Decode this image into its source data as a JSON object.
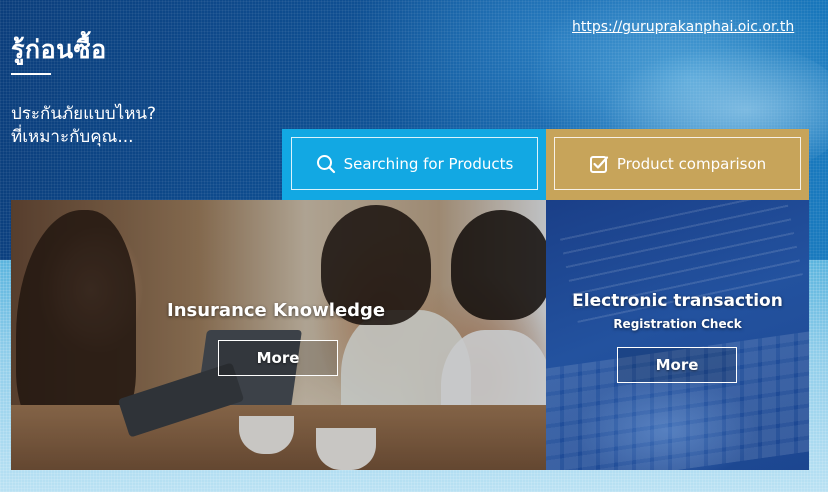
{
  "header": {
    "title": "รู้ก่อนซื้อ",
    "subtitle_line1": "ประกันภัยแบบไหน?",
    "subtitle_line2": "ที่เหมาะกับคุณ...",
    "url": "https://guruprakanphai.oic.or.th"
  },
  "actions": {
    "search": {
      "label": "Searching for Products",
      "icon": "search-icon"
    },
    "compare": {
      "label": "Product comparison",
      "icon": "checkbox-icon"
    }
  },
  "cards": {
    "knowledge": {
      "title": "Insurance Knowledge",
      "button": "More"
    },
    "electronic": {
      "title": "Electronic transaction",
      "subtitle": "Registration Check",
      "button": "More"
    }
  },
  "colors": {
    "search_panel": "#12a8e3",
    "compare_panel": "#c7a45a",
    "electronic_card": "#23529f"
  }
}
